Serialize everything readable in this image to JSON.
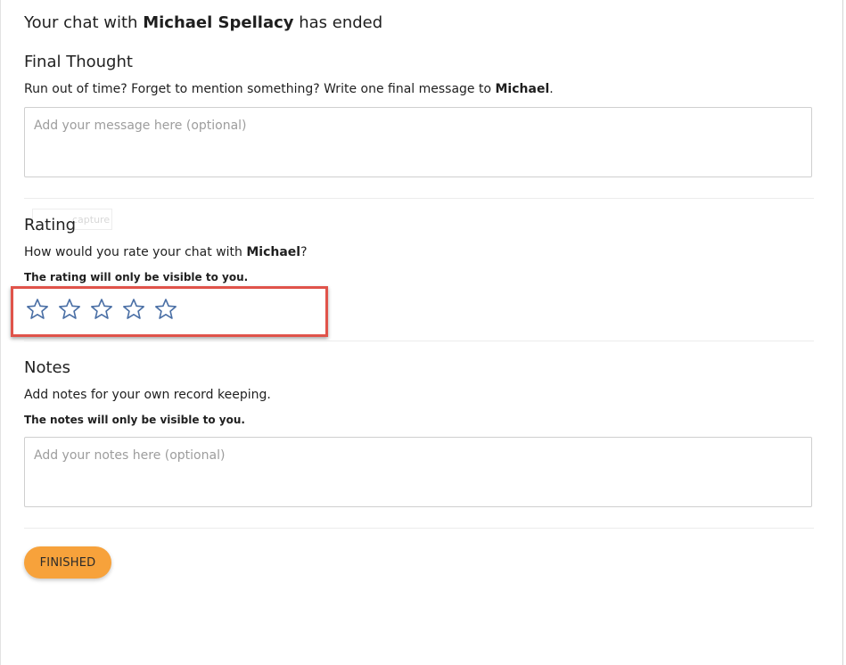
{
  "header": {
    "prefix": "Your chat with",
    "name": "Michael Spellacy",
    "suffix": "has ended"
  },
  "final_thought": {
    "title": "Final Thought",
    "desc_prefix": "Run out of time? Forget to mention something? Write one final message to",
    "desc_name": "Michael",
    "desc_suffix": ".",
    "placeholder": "Add your message here (optional)"
  },
  "rating": {
    "title": "Rating",
    "ghost_label": "capture",
    "desc_prefix": "How would you rate your chat with",
    "desc_name": "Michael",
    "desc_suffix": "?",
    "visibility_note": "The rating will only be visible to you.",
    "stars_total": 5,
    "stars_selected": 0,
    "star_color": "#4a6fa5",
    "highlight_color": "#e0534a"
  },
  "notes": {
    "title": "Notes",
    "desc": "Add notes for your own record keeping.",
    "visibility_note": "The notes will only be visible to you.",
    "placeholder": "Add your notes here (optional)"
  },
  "finish": {
    "label": "FINISHED",
    "color": "#f7a23b"
  }
}
